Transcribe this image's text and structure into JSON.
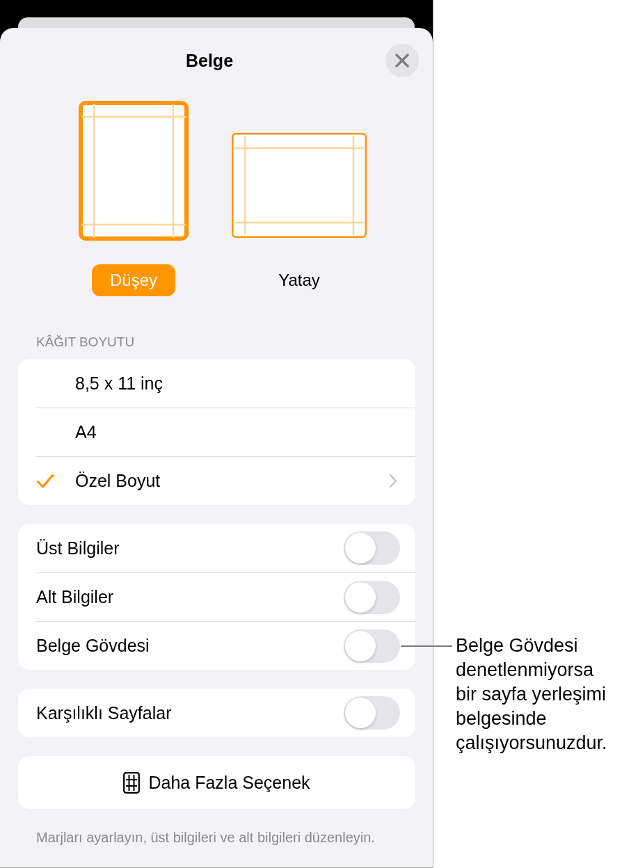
{
  "window": {
    "title": "Belge"
  },
  "orientations": [
    {
      "kind": "portrait",
      "label": "Düşey",
      "selected": true
    },
    {
      "kind": "landscape",
      "label": "Yatay",
      "selected": false
    }
  ],
  "paper_size": {
    "header": "KÂĞIT BOYUTU",
    "items": [
      {
        "label": "8,5 x 11 inç",
        "selected": false,
        "disclosure": false
      },
      {
        "label": "A4",
        "selected": false,
        "disclosure": false
      },
      {
        "label": "Özel Boyut",
        "selected": true,
        "disclosure": true
      }
    ]
  },
  "toggle_groups": [
    {
      "items": [
        {
          "label": "Üst Bilgiler",
          "on": false
        },
        {
          "label": "Alt Bilgiler",
          "on": false
        },
        {
          "label": "Belge Gövdesi",
          "on": false
        }
      ]
    },
    {
      "items": [
        {
          "label": "Karşılıklı Sayfalar",
          "on": false
        }
      ]
    }
  ],
  "more_button": {
    "label": "Daha Fazla Seçenek"
  },
  "footer": "Marjları ayarlayın, üst bilgileri ve alt bilgileri düzenleyin.",
  "callout": {
    "text": "Belge Gövdesi denetlenmiyorsa bir sayfa yerleşimi belgesinde çalışıyorsunuzdur."
  }
}
